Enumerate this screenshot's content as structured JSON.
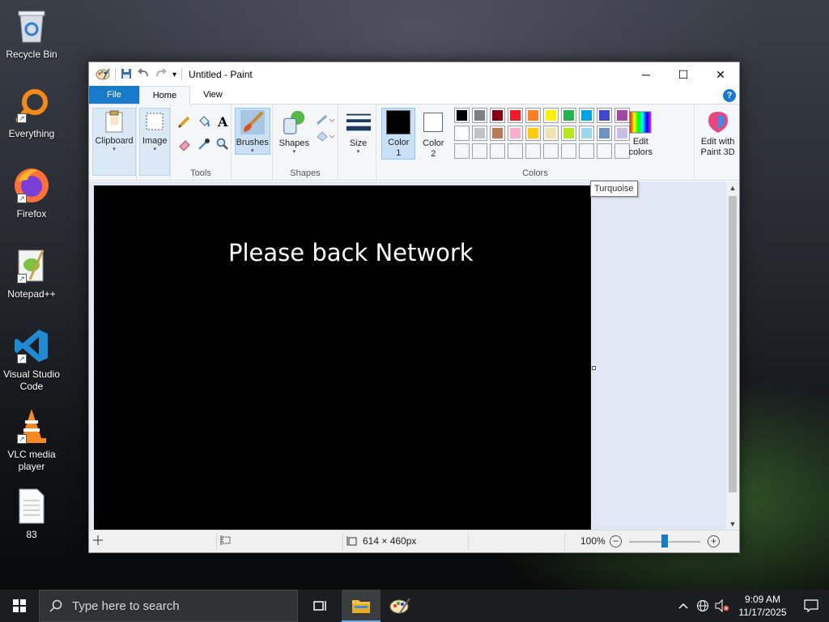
{
  "desktop": {
    "icons": [
      {
        "label": "Recycle Bin"
      },
      {
        "label": "Everything"
      },
      {
        "label": "Firefox"
      },
      {
        "label": "Notepad++"
      },
      {
        "label": "Visual Studio Code"
      },
      {
        "label": "VLC media player"
      },
      {
        "label": "83"
      }
    ]
  },
  "window": {
    "title": "Untitled - Paint",
    "minimize_glyph": "─",
    "maximize_glyph": "☐",
    "close_glyph": "✕"
  },
  "tabs": {
    "file": "File",
    "home": "Home",
    "view": "View",
    "help": "?"
  },
  "ribbon": {
    "clipboard": "Clipboard",
    "image": "Image",
    "tools_group": "Tools",
    "brushes": "Brushes",
    "shapes": "Shapes",
    "shapes_group": "Shapes",
    "size": "Size",
    "color1_line1": "Color",
    "color1_line2": "1",
    "color2_line1": "Color",
    "color2_line2": "2",
    "colors_group": "Colors",
    "edit_colors_line1": "Edit",
    "edit_colors_line2": "colors",
    "paint3d_line1": "Edit with",
    "paint3d_line2": "Paint 3D",
    "text_tool_glyph": "A",
    "dropdown_glyph": "▾"
  },
  "palette": {
    "row1": [
      "#000000",
      "#7f7f7f",
      "#880015",
      "#ed1c24",
      "#ff7f27",
      "#fff200",
      "#22b14c",
      "#00a2e8",
      "#3f48cc",
      "#a349a4"
    ],
    "row2": [
      "#ffffff",
      "#c3c3c3",
      "#b97a57",
      "#ffaec9",
      "#ffc90e",
      "#efe4b0",
      "#b5e61d",
      "#99d9ea",
      "#7092be",
      "#c8bfe7"
    ],
    "row3": [
      "#f5f6f7",
      "#f5f6f7",
      "#f5f6f7",
      "#f5f6f7",
      "#f5f6f7",
      "#f5f6f7",
      "#f5f6f7",
      "#f5f6f7",
      "#f5f6f7",
      "#f5f6f7"
    ],
    "color1": "#000000",
    "color2": "#ffffff"
  },
  "canvas": {
    "text": "Please back Network",
    "background": "#000000"
  },
  "tooltip": "Turquoise",
  "statusbar": {
    "dimensions": "614 × 460px",
    "zoom": "100%",
    "zoom_out": "−",
    "zoom_in": "+"
  },
  "taskbar": {
    "search_placeholder": "Type here to search",
    "time": "9:09 AM",
    "date": "11/17/2025"
  }
}
